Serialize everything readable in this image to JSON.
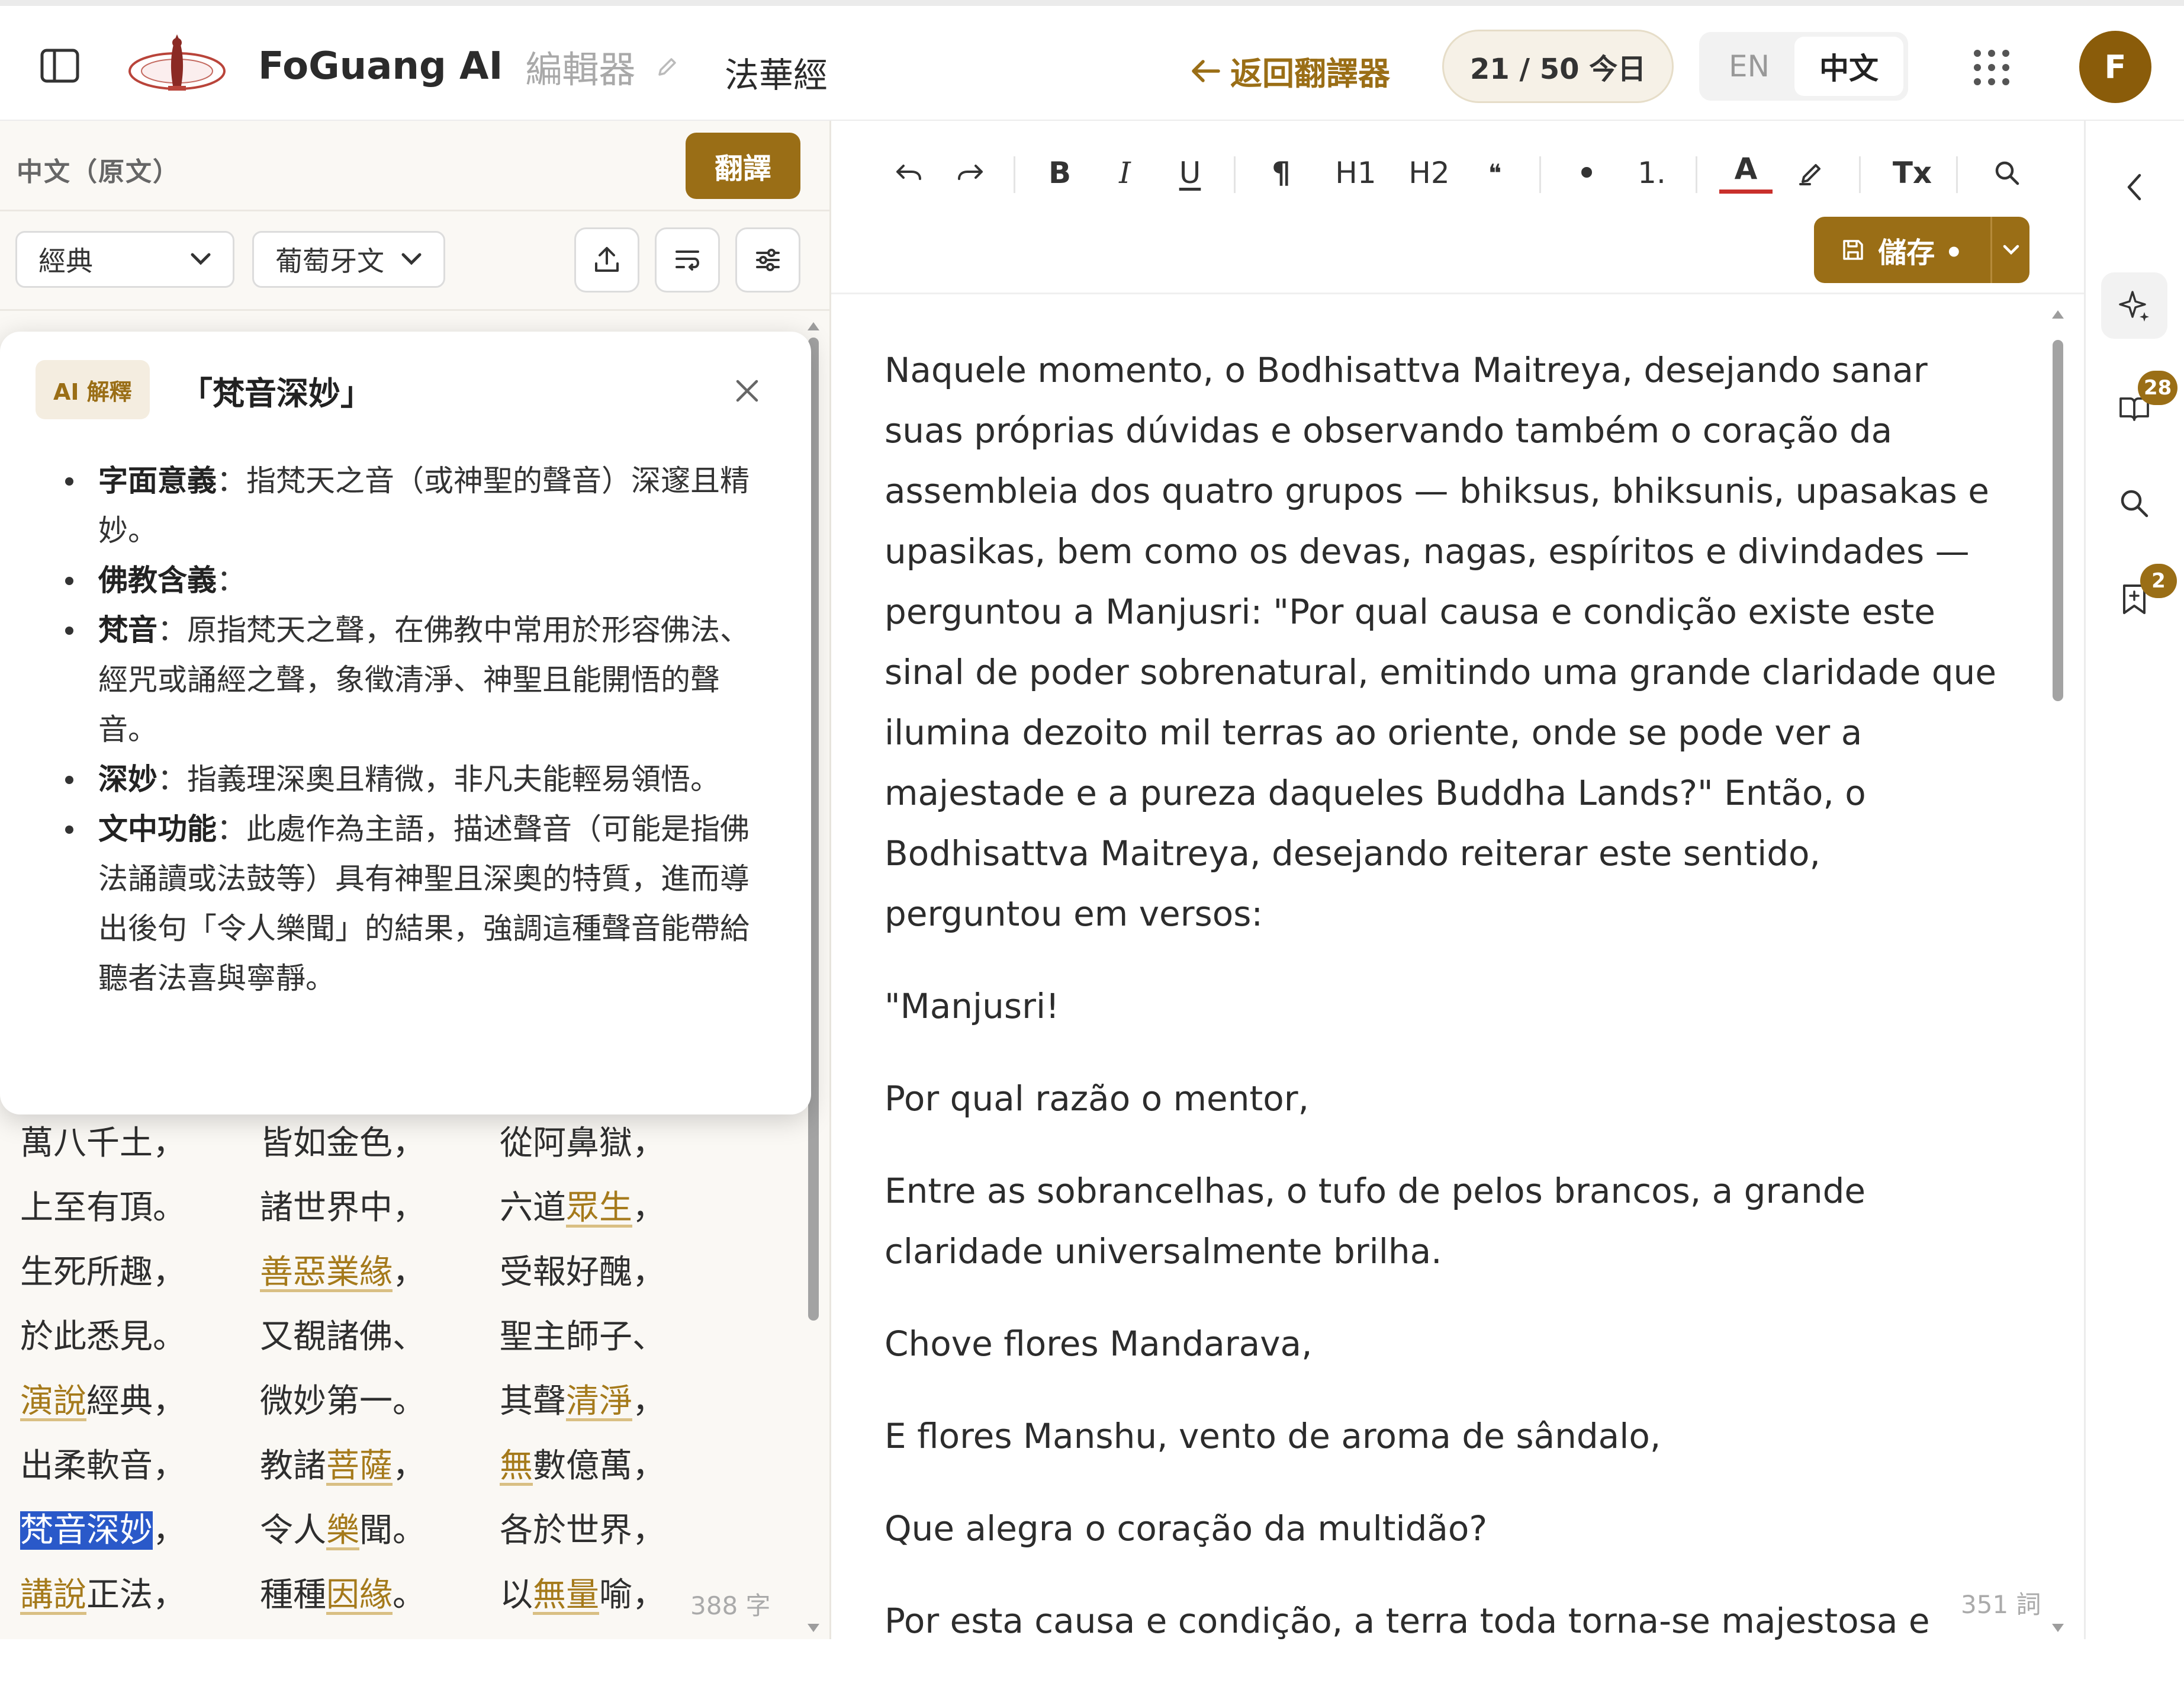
{
  "header": {
    "brand_name": "FoGuang AI",
    "brand_subtitle": "編輯器",
    "document_title": "法華經",
    "back_link": "返回翻譯器",
    "usage_count": "21 / 50 今日",
    "lang_en": "EN",
    "lang_zh": "中文",
    "avatar_initial": "F"
  },
  "left_panel": {
    "title": "中文（原文）",
    "translate_button": "翻譯",
    "genre_select": "經典",
    "target_language_select": "葡萄牙文",
    "char_count": "388 字",
    "scripture_rows": [
      [
        [
          {
            "t": "萬八千土，"
          }
        ],
        [
          {
            "t": "皆如金色，"
          }
        ],
        [
          {
            "t": "從阿鼻獄，"
          }
        ]
      ],
      [
        [
          {
            "t": "上至有頂。"
          }
        ],
        [
          {
            "t": "諸世界中，"
          }
        ],
        [
          {
            "t": "六道"
          },
          {
            "t": "眾生",
            "k": "term"
          },
          {
            "t": "，"
          }
        ]
      ],
      [
        [
          {
            "t": "生死所趣，"
          }
        ],
        [
          {
            "t": "善惡業緣",
            "k": "term"
          },
          {
            "t": "，"
          }
        ],
        [
          {
            "t": "受報好醜，"
          }
        ]
      ],
      [
        [
          {
            "t": "於此悉見。"
          }
        ],
        [
          {
            "t": "又覩諸佛、"
          }
        ],
        [
          {
            "t": "聖主師子、"
          }
        ]
      ],
      [
        [
          {
            "t": "演說",
            "k": "term"
          },
          {
            "t": "經典，"
          }
        ],
        [
          {
            "t": "微妙第一。"
          }
        ],
        [
          {
            "t": "其聲"
          },
          {
            "t": "清淨",
            "k": "term"
          },
          {
            "t": "，"
          }
        ]
      ],
      [
        [
          {
            "t": "出柔軟音，"
          }
        ],
        [
          {
            "t": "教諸"
          },
          {
            "t": "菩薩",
            "k": "term"
          },
          {
            "t": "，"
          }
        ],
        [
          {
            "t": "無",
            "k": "term"
          },
          {
            "t": "數億萬，"
          }
        ]
      ],
      [
        [
          {
            "t": "梵音深妙",
            "k": "sel"
          },
          {
            "t": "，"
          }
        ],
        [
          {
            "t": "令人"
          },
          {
            "t": "樂",
            "k": "term"
          },
          {
            "t": "聞。"
          }
        ],
        [
          {
            "t": "各於世界，"
          }
        ]
      ],
      [
        [
          {
            "t": "講說",
            "k": "term"
          },
          {
            "t": "正法，"
          }
        ],
        [
          {
            "t": "種種"
          },
          {
            "t": "因緣",
            "k": "term"
          },
          {
            "t": "。"
          }
        ],
        [
          {
            "t": "以"
          },
          {
            "t": "無量",
            "k": "term"
          },
          {
            "t": "喻，"
          }
        ]
      ]
    ]
  },
  "ai_popover": {
    "badge": "AI 解釋",
    "term": "「梵音深妙」",
    "items": [
      {
        "label": "字面意義",
        "text": "：指梵天之音（或神聖的聲音）深邃且精妙。"
      },
      {
        "label": "佛教含義",
        "text": "："
      },
      {
        "label": "梵音",
        "text": "：原指梵天之聲，在佛教中常用於形容佛法、經咒或誦經之聲，象徵清淨、神聖且能開悟的聲音。"
      },
      {
        "label": "深妙",
        "text": "：指義理深奧且精微，非凡夫能輕易領悟。"
      },
      {
        "label": "文中功能",
        "text": "：此處作為主語，描述聲音（可能是指佛法誦讀或法鼓等）具有神聖且深奧的特質，進而導出後句「令人樂聞」的結果，強調這種聲音能帶給聽者法喜與寧靜。"
      }
    ]
  },
  "editor": {
    "toolbar": {
      "bold": "B",
      "italic": "I",
      "underline": "U",
      "paragraph": "¶",
      "h1": "H1",
      "h2": "H2",
      "quote": "❝",
      "bullet": "•",
      "ordered": "1.",
      "text_color": "A",
      "clear_format": "Tx"
    },
    "save_button": "儲存 •",
    "word_count": "351 詞",
    "paragraphs": [
      "Naquele momento, o Bodhisattva Maitreya, desejando sanar suas próprias dúvidas e observando também o coração da assembleia dos quatro grupos — bhiksus, bhiksunis, upasakas e upasikas, bem como os devas, nagas, espíritos e divindades — perguntou a Manjusri: \"Por qual causa e condição existe este sinal de poder sobrenatural, emitindo uma grande claridade que ilumina dezoito mil terras ao oriente, onde se pode ver a majestade e a pureza daqueles Buddha Lands?\" Então, o Bodhisattva Maitreya, desejando reiterar este sentido, perguntou em versos:",
      "\"Manjusri!",
      "Por qual razão o mentor,",
      "Entre as sobrancelhas, o tufo de pelos brancos, a grande claridade universalmente brilha.",
      "Chove flores Mandarava,",
      "E flores Manshu, vento de aroma de sândalo,",
      "Que alegra o coração da multidão?",
      "Por esta causa e condição, a terra toda torna-se majestosa e"
    ]
  },
  "right_rail": {
    "badge_book": "28",
    "badge_bookmark": "2"
  },
  "colors": {
    "accent": "#9a6e16",
    "selection": "#2a59c9",
    "term": "#a57a1b"
  }
}
